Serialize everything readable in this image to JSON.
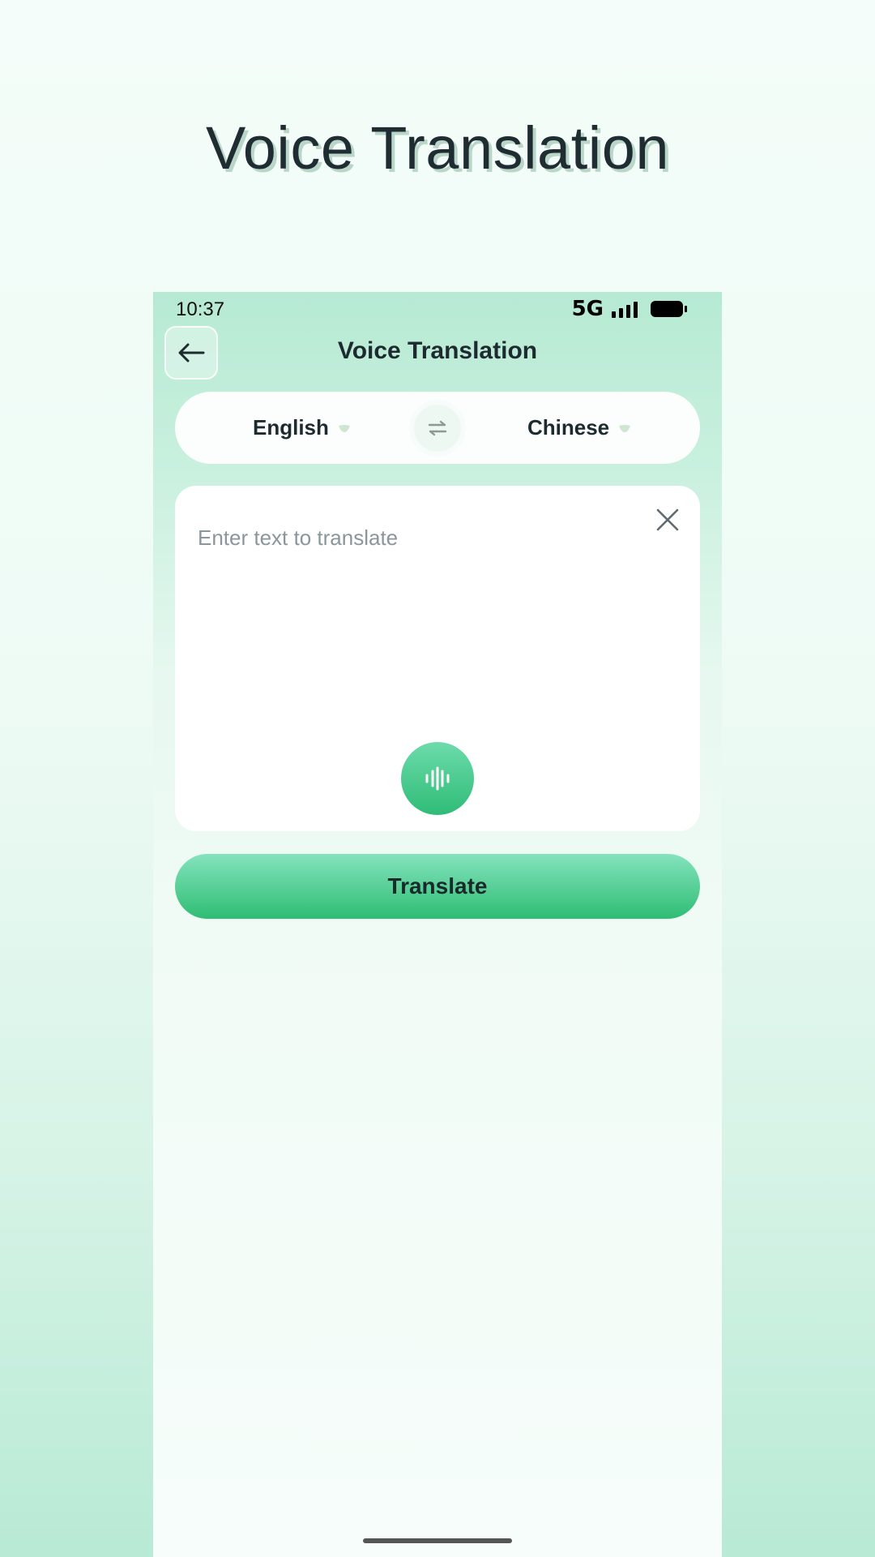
{
  "promo": {
    "title": "Voice Translation"
  },
  "status_bar": {
    "time": "10:37",
    "network": "5G"
  },
  "header": {
    "title": "Voice Translation",
    "back_icon": "arrow-left-icon"
  },
  "languages": {
    "source": "English",
    "target": "Chinese",
    "swap_icon": "swap-arrows-icon",
    "caret_icon": "caret-down-icon"
  },
  "input": {
    "placeholder": "Enter text to translate",
    "value": "",
    "clear_icon": "close-icon",
    "mic_icon": "sound-wave-icon"
  },
  "actions": {
    "translate_label": "Translate"
  },
  "colors": {
    "accent": "#2fbc77",
    "accent_light": "#84e3bd",
    "text_dark": "#1d2a30",
    "placeholder": "#8a969c"
  }
}
